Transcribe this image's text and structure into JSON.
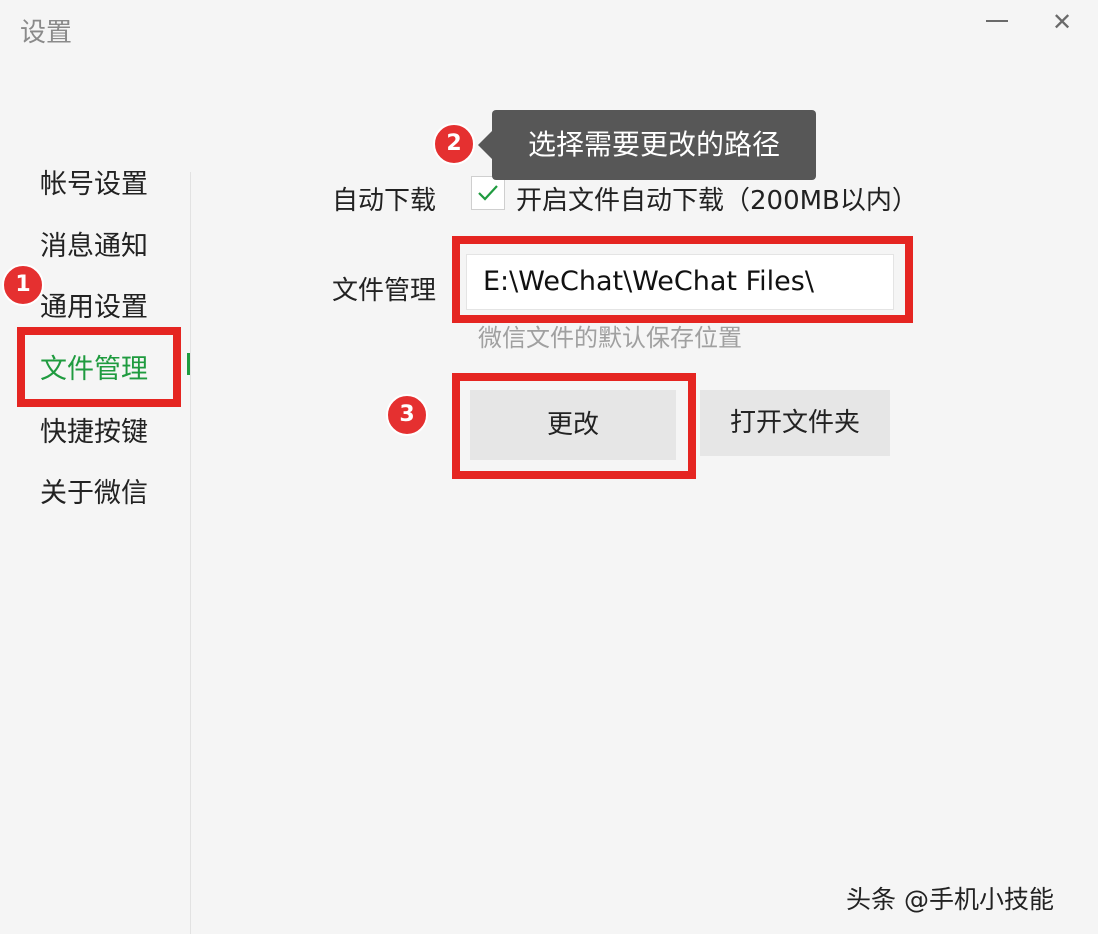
{
  "window": {
    "title": "设置",
    "minimize_icon": "minimize-icon",
    "close_glyph": "✕"
  },
  "sidebar": {
    "items": [
      {
        "label": "帐号设置",
        "active": false
      },
      {
        "label": "消息通知",
        "active": false
      },
      {
        "label": "通用设置",
        "active": false
      },
      {
        "label": "文件管理",
        "active": true
      },
      {
        "label": "快捷按键",
        "active": false
      },
      {
        "label": "关于微信",
        "active": false
      }
    ]
  },
  "main": {
    "auto_download": {
      "label": "自动下载",
      "checked": true,
      "checkbox_label": "开启文件自动下载（200MB以内）"
    },
    "file_management": {
      "label": "文件管理",
      "path": "E:\\WeChat\\WeChat Files\\",
      "hint": "微信文件的默认保存位置"
    },
    "buttons": {
      "change": "更改",
      "open_folder": "打开文件夹"
    }
  },
  "annotations": {
    "step1": "1",
    "step2": "2",
    "step3": "3",
    "tooltip": "选择需要更改的路径",
    "highlight_color": "#e52521"
  },
  "colors": {
    "accent_green": "#1f9b3f",
    "tooltip_bg": "#575757",
    "badge_red": "#e53030"
  },
  "watermark": "头条 @手机小技能"
}
